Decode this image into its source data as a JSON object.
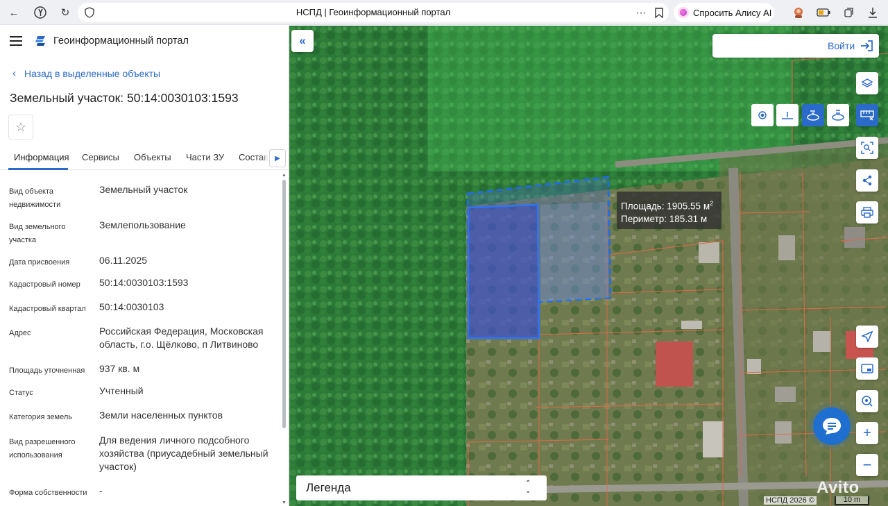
{
  "browser": {
    "tab_title": "НСПД | Геоинформационный портал",
    "alice_label": "Спросить Алису AI",
    "alice_color": "#b046e0"
  },
  "portal": {
    "title": "Геоинформационный портал",
    "back_label": "Назад в выделенные объекты",
    "parcel_title": "Земельный участок: 50:14:0030103:1593",
    "accent_color": "#2a6ac8"
  },
  "tabs": [
    {
      "label": "Информация",
      "active": true
    },
    {
      "label": "Сервисы"
    },
    {
      "label": "Объекты"
    },
    {
      "label": "Части ЗУ"
    },
    {
      "label": "Состав"
    }
  ],
  "info": [
    {
      "label": "Вид объекта недвижимости",
      "value": "Земельный участок"
    },
    {
      "label": "Вид земельного участка",
      "value": "Землепользование"
    },
    {
      "label": "Дата присвоения",
      "value": "06.11.2025"
    },
    {
      "label": "Кадастровый номер",
      "value": "50:14:0030103:1593"
    },
    {
      "label": "Кадастровый квартал",
      "value": "50:14:0030103"
    },
    {
      "label": "Адрес",
      "value": "Российская Федерация, Московская область, г.о. Щёлково, п Литвиново"
    },
    {
      "label": "Площадь уточненная",
      "value": "937 кв. м"
    },
    {
      "label": "Статус",
      "value": "Учтенный"
    },
    {
      "label": "Категория земель",
      "value": "Земли населенных пунктов"
    },
    {
      "label": "Вид разрешенного использования",
      "value": "Для ведения личного подсобного хозяйства (приусадебный земельный участок)"
    },
    {
      "label": "Форма собственности",
      "value": "-"
    }
  ],
  "map": {
    "login_label": "Войти",
    "measure_area": "Площадь: 1905.55 м",
    "measure_area_unit_sup": "2",
    "measure_perimeter": "Периметр: 185.31 м",
    "legend_label": "Легенда",
    "copyright": "НСПД 2026 ©",
    "scale_label": "10 m",
    "watermark": "Avito"
  }
}
